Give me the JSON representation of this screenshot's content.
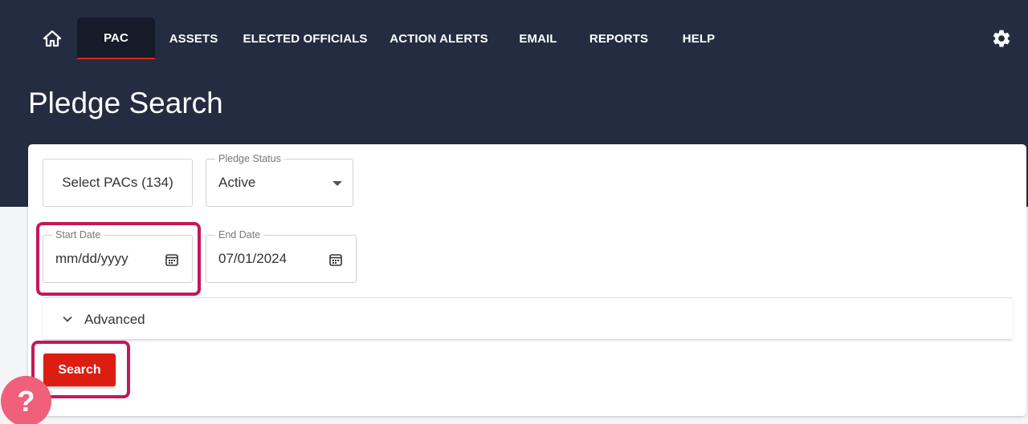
{
  "nav": {
    "home_icon": "home-icon",
    "items": [
      {
        "label": "PAC",
        "active": true
      },
      {
        "label": "ASSETS"
      },
      {
        "label": "ELECTED OFFICIALS"
      },
      {
        "label": "ACTION ALERTS"
      },
      {
        "label": "EMAIL"
      },
      {
        "label": "REPORTS"
      },
      {
        "label": "HELP"
      }
    ],
    "settings_icon": "gear-icon"
  },
  "page": {
    "title": "Pledge Search"
  },
  "filters": {
    "select_pacs_label": "Select PACs (134)",
    "pledge_status": {
      "label": "Pledge Status",
      "value": "Active"
    },
    "start_date": {
      "label": "Start Date",
      "value": "mm/dd/yyyy"
    },
    "end_date": {
      "label": "End Date",
      "value": "07/01/2024"
    }
  },
  "advanced": {
    "label": "Advanced"
  },
  "search_button": {
    "label": "Search"
  },
  "help_bubble": {
    "label": "?"
  },
  "colors": {
    "header_bg": "#232c40",
    "active_tab_bg": "#151b29",
    "accent_red": "#dc1e12",
    "highlight": "#c5175a",
    "help_bubble": "#f0607a"
  }
}
